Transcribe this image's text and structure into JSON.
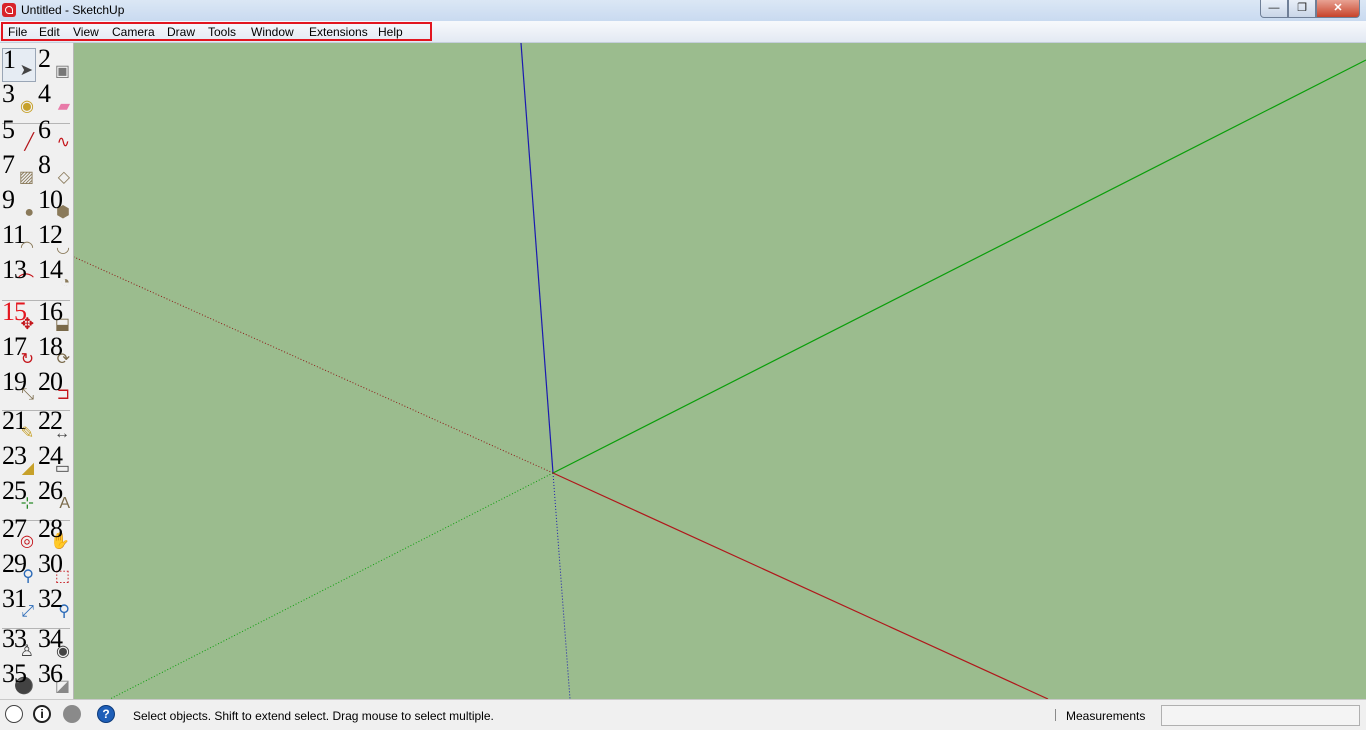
{
  "window": {
    "title": "Untitled - SketchUp",
    "min_glyph": "—",
    "max_glyph": "❐",
    "close_glyph": "✕"
  },
  "menu": [
    "File",
    "Edit",
    "View",
    "Camera",
    "Draw",
    "Tools",
    "Window",
    "Extensions",
    "Help"
  ],
  "tools": [
    {
      "n": "1",
      "icon": "select-arrow-icon"
    },
    {
      "n": "2",
      "icon": "make-component-icon"
    },
    {
      "n": "3",
      "icon": "paint-bucket-icon"
    },
    {
      "n": "4",
      "icon": "eraser-icon"
    },
    {
      "n": "5",
      "icon": "line-pencil-icon"
    },
    {
      "n": "6",
      "icon": "freehand-icon"
    },
    {
      "n": "7",
      "icon": "rectangle-icon"
    },
    {
      "n": "8",
      "icon": "rotated-rectangle-icon"
    },
    {
      "n": "9",
      "icon": "circle-icon"
    },
    {
      "n": "10",
      "icon": "polygon-icon"
    },
    {
      "n": "11",
      "icon": "arc-icon"
    },
    {
      "n": "12",
      "icon": "two-point-arc-icon"
    },
    {
      "n": "13",
      "icon": "three-point-arc-icon"
    },
    {
      "n": "14",
      "icon": "pie-icon"
    },
    {
      "n": "15",
      "icon": "move-icon"
    },
    {
      "n": "16",
      "icon": "push-pull-icon"
    },
    {
      "n": "17",
      "icon": "rotate-icon"
    },
    {
      "n": "18",
      "icon": "follow-me-icon"
    },
    {
      "n": "19",
      "icon": "scale-icon"
    },
    {
      "n": "20",
      "icon": "offset-icon"
    },
    {
      "n": "21",
      "icon": "tape-measure-icon"
    },
    {
      "n": "22",
      "icon": "dimension-icon"
    },
    {
      "n": "23",
      "icon": "protractor-icon"
    },
    {
      "n": "24",
      "icon": "text-icon"
    },
    {
      "n": "25",
      "icon": "axes-icon"
    },
    {
      "n": "26",
      "icon": "3d-text-icon"
    },
    {
      "n": "27",
      "icon": "orbit-icon"
    },
    {
      "n": "28",
      "icon": "pan-icon"
    },
    {
      "n": "29",
      "icon": "zoom-icon"
    },
    {
      "n": "30",
      "icon": "zoom-window-icon"
    },
    {
      "n": "31",
      "icon": "zoom-extents-icon"
    },
    {
      "n": "32",
      "icon": "previous-view-icon"
    },
    {
      "n": "33",
      "icon": "position-camera-icon"
    },
    {
      "n": "34",
      "icon": "look-around-icon"
    },
    {
      "n": "35",
      "icon": "walk-icon"
    },
    {
      "n": "36",
      "icon": "section-plane-icon"
    }
  ],
  "status": {
    "message": "Select objects. Shift to extend select. Drag mouse to select multiple.",
    "measurements_label": "Measurements",
    "measurements_value": "",
    "credit_glyph": "i",
    "help_glyph": "?"
  },
  "colors": {
    "viewport_bg": "#9bbc8e",
    "red_axis": "#b0171b",
    "green_axis": "#0a9e0a",
    "blue_axis": "#1a1ab0",
    "highlight": "#e2151f"
  }
}
